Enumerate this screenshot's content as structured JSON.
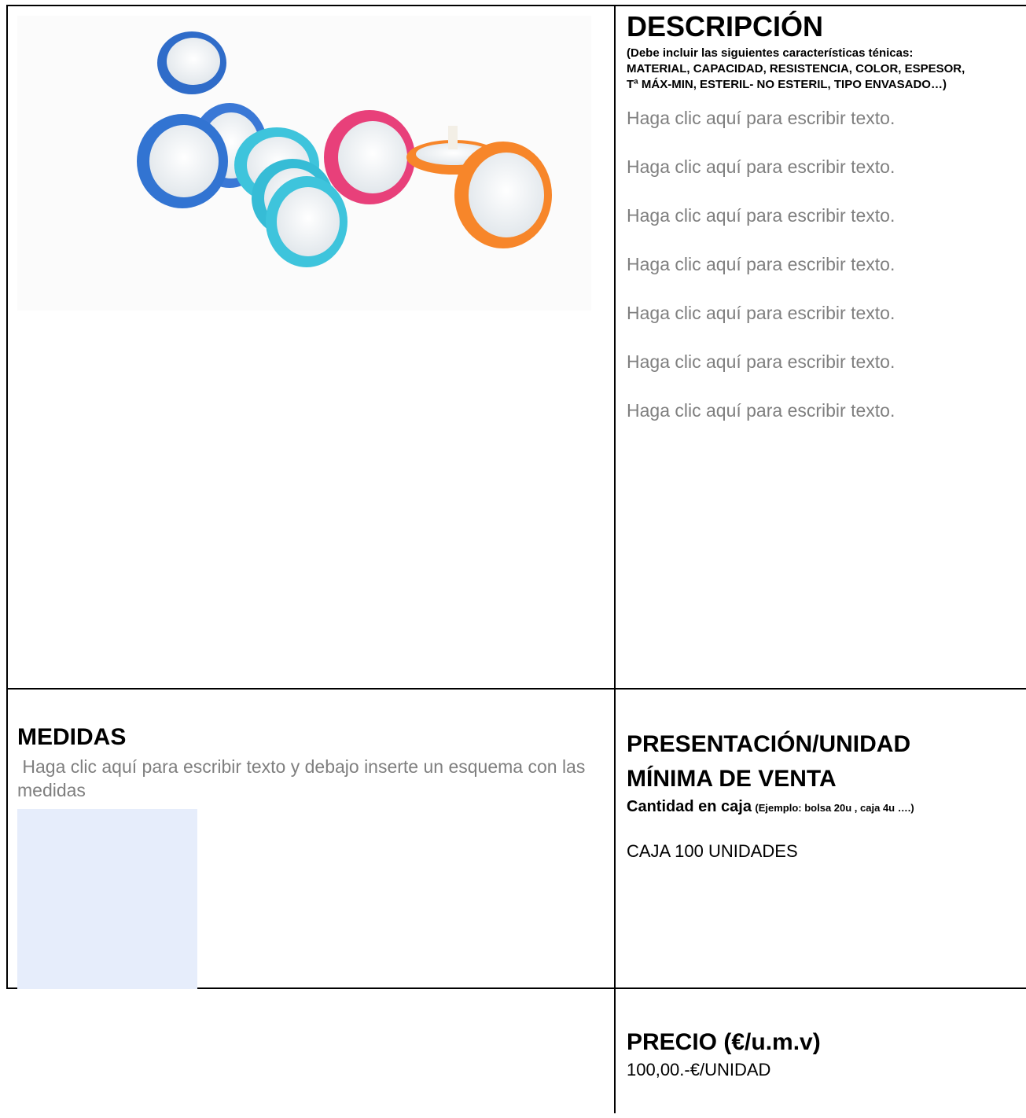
{
  "descripcion": {
    "title": "DESCRIPCIÓN",
    "note": "(Debe incluir las siguientes características ténicas: MATERIAL, CAPACIDAD, RESISTENCIA, COLOR, ESPESOR, Tª MÁX-MIN, ESTERIL- NO ESTERIL, TIPO ENVASADO…)",
    "placeholders": [
      "Haga clic aquí para escribir texto.",
      "Haga clic aquí para escribir texto.",
      "Haga clic aquí para escribir texto.",
      "Haga clic aquí para escribir texto.",
      "Haga clic aquí para escribir texto.",
      "Haga clic aquí para escribir texto.",
      "Haga clic aquí para escribir texto."
    ]
  },
  "medidas": {
    "title": "MEDIDAS",
    "placeholder": " Haga clic aquí para escribir texto y debajo inserte un esquema con las medidas"
  },
  "presentacion": {
    "title_line1": "PRESENTACIÓN/UNIDAD",
    "title_line2": "MÍNIMA DE VENTA",
    "subtitle": "Cantidad en caja",
    "example": "(Ejemplo: bolsa 20u , caja 4u ….)",
    "value": "CAJA 100 UNIDADES"
  },
  "precio": {
    "title": "PRECIO (€/u.m.v)",
    "value": "100,00.-€/UNIDAD"
  },
  "colors": {
    "placeholder": "#7f7f7f",
    "schema_box": "#e6edfb",
    "filter_blue": "#3a78d6",
    "filter_cyan": "#3ec4dc",
    "filter_pink": "#e8407a",
    "filter_orange": "#f7862a"
  }
}
